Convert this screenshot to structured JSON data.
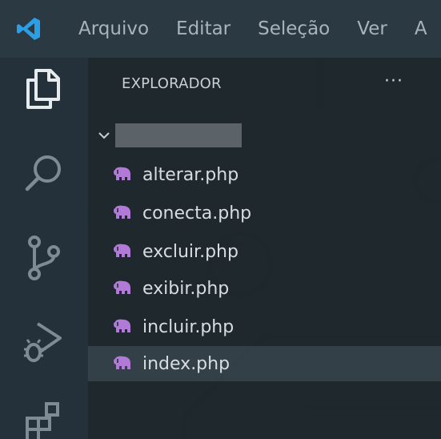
{
  "menubar": {
    "items": [
      "Arquivo",
      "Editar",
      "Seleção",
      "Ver",
      "A"
    ]
  },
  "activitybar": {
    "icons": [
      "explorer-icon",
      "search-icon",
      "source-control-icon",
      "run-debug-icon",
      "extensions-icon"
    ]
  },
  "explorer": {
    "title": "EXPLORADOR",
    "more_label": "···",
    "files": [
      {
        "name": "alterar.php",
        "selected": false
      },
      {
        "name": "conecta.php",
        "selected": false
      },
      {
        "name": "excluir.php",
        "selected": false
      },
      {
        "name": "exibir.php",
        "selected": false
      },
      {
        "name": "incluir.php",
        "selected": false
      },
      {
        "name": "index.php",
        "selected": true
      }
    ]
  },
  "colors": {
    "accent_blue": "#2b9fe6",
    "php_icon": "#b07ad6",
    "text": "#d7dde1",
    "menu_text": "#a8b3bb"
  }
}
